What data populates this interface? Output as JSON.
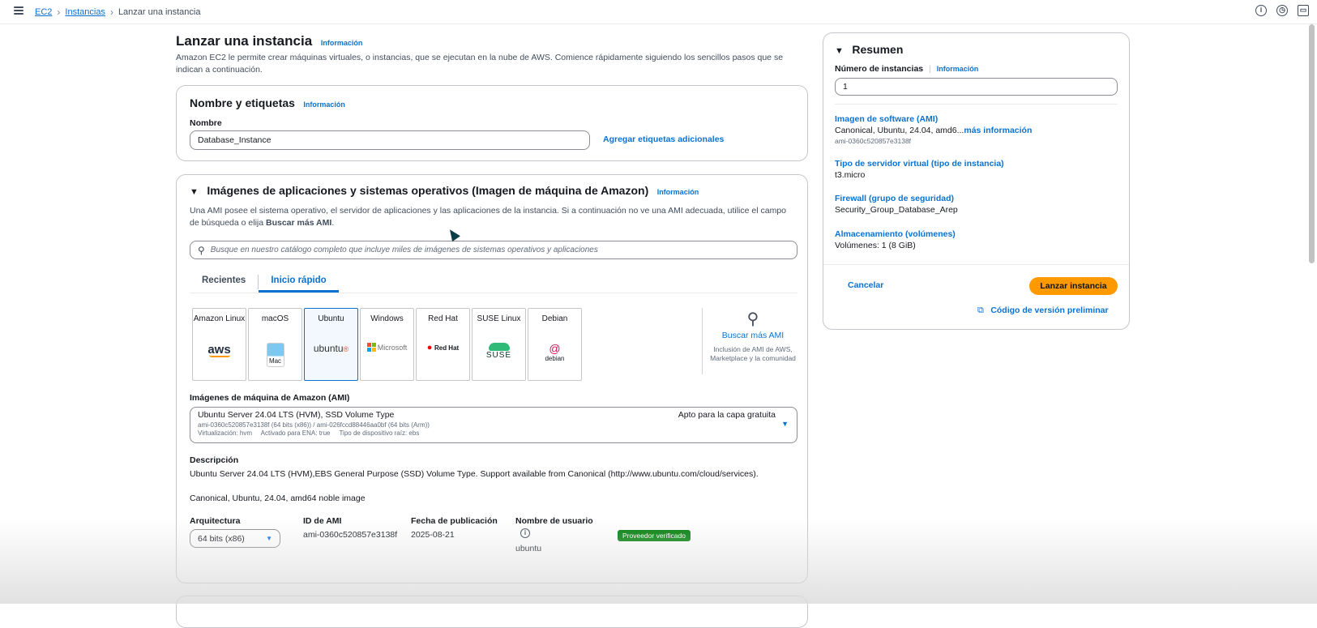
{
  "breadcrumb": {
    "root": "EC2",
    "instances": "Instancias",
    "current": "Lanzar una instancia"
  },
  "header": {
    "title": "Lanzar una instancia",
    "info": "Información",
    "description": "Amazon EC2 le permite crear máquinas virtuales, o instancias, que se ejecutan en la nube de AWS. Comience rápidamente siguiendo los sencillos pasos que se indican a continuación."
  },
  "name_tags": {
    "title": "Nombre y etiquetas",
    "info": "Información",
    "name_label": "Nombre",
    "name_value": "Database_Instance",
    "add_tags": "Agregar etiquetas adicionales"
  },
  "ami_section": {
    "title": "Imágenes de aplicaciones y sistemas operativos (Imagen de máquina de Amazon)",
    "info": "Información",
    "description_prefix": "Una AMI posee el sistema operativo, el servidor de aplicaciones y las aplicaciones de la instancia. Si a continuación no ve una AMI adecuada, utilice el campo de búsqueda o elija ",
    "description_bold": "Buscar más AMI",
    "description_suffix": ".",
    "search_placeholder": "Busque en nuestro catálogo completo que incluye miles de imágenes de sistemas operativos y aplicaciones",
    "tabs": [
      "Recientes",
      "Inicio rápido"
    ],
    "os_tiles": [
      {
        "name": "Amazon Linux",
        "logo": "aws"
      },
      {
        "name": "macOS",
        "logo": "Mac"
      },
      {
        "name": "Ubuntu",
        "logo": "ubuntu"
      },
      {
        "name": "Windows",
        "logo": "Microsoft"
      },
      {
        "name": "Red Hat",
        "logo": "Red Hat"
      },
      {
        "name": "SUSE Linux",
        "logo": "SUSE"
      },
      {
        "name": "Debian",
        "logo": "debian"
      }
    ],
    "browse_more": "Buscar más AMI",
    "browse_more_desc": "Inclusión de AMI de AWS, Marketplace y la comunidad",
    "ami_label": "Imágenes de máquina de Amazon (AMI)",
    "ami_name": "Ubuntu Server 24.04 LTS (HVM), SSD Volume Type",
    "ami_ids": "ami-0360c520857e3138f (64 bits (x86)) / ami-026fccd88446aa0bf (64 bits (Arm))",
    "ami_meta": "Virtualización: hvm     Activado para ENA: true     Tipo de dispositivo raíz: ebs",
    "free_tier": "Apto para la capa gratuita",
    "desc_label": "Descripción",
    "desc_text": "Ubuntu Server 24.04 LTS (HVM),EBS General Purpose (SSD) Volume Type. Support available from Canonical (http://www.ubuntu.com/cloud/services).",
    "desc_text2": "Canonical, Ubuntu, 24.04, amd64 noble image",
    "arch_label": "Arquitectura",
    "arch_value": "64 bits (x86)",
    "ami_id_label": "ID de AMI",
    "ami_id_value": "ami-0360c520857e3138f",
    "pub_date_label": "Fecha de publicación",
    "pub_date_value": "2025-08-21",
    "user_label": "Nombre de usuario",
    "user_value": "ubuntu",
    "verified": "Proveedor verificado"
  },
  "summary": {
    "title": "Resumen",
    "instances_label": "Número de instancias",
    "info": "Información",
    "instances_value": "1",
    "ami_label": "Imagen de software (AMI)",
    "ami_value": "Canonical, Ubuntu, 24.04, amd6...",
    "ami_more": "más información",
    "ami_sub": "ami-0360c520857e3138f",
    "type_label": "Tipo de servidor virtual (tipo de instancia)",
    "type_value": "t3.micro",
    "firewall_label": "Firewall (grupo de seguridad)",
    "firewall_value": "Security_Group_Database_Arep",
    "storage_label": "Almacenamiento (volúmenes)",
    "storage_value": "Volúmenes: 1 (8 GiB)",
    "cancel": "Cancelar",
    "launch": "Lanzar instancia",
    "preview_code": "Código de versión preliminar"
  },
  "colors": {
    "accent": "#0972d3",
    "primary_button": "#ff9900",
    "verified": "#037f0c"
  }
}
